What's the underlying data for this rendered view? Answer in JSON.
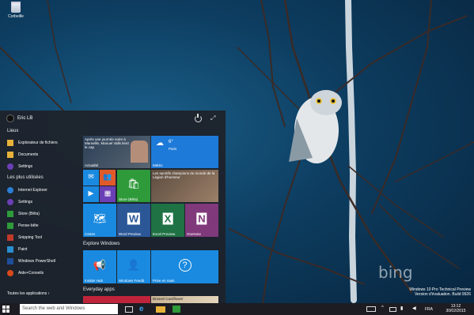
{
  "desktop": {
    "recycle_label": "Corbeille",
    "bing_text": "bing"
  },
  "watermark": {
    "line1": "Windows 10 Pro Technical Preview",
    "line2": "Version d'évaluation. Build 9926"
  },
  "start_menu": {
    "user_name": "Eric LB",
    "places_header": "Lieux",
    "places": [
      "Explorateur de fichiers",
      "Documents",
      "Settings"
    ],
    "most_used_header": "Les plus utilisées",
    "most_used": [
      "Internet Explorer",
      "Settings",
      "Store (Bêta)",
      "Pense-bête",
      "Snipping Tool",
      "Paint",
      "Windows PowerShell",
      "Aide+Conseils"
    ],
    "all_apps": "Toutes les applications ›"
  },
  "tiles": {
    "news_headline": "Après une journée noire à Marseille, Manuel Valls tient le cap",
    "news_label": "Actualité",
    "weather_temp": "6°",
    "weather_city": "Paris",
    "weather_label": "Météo",
    "sports_headline": "Les sportifs champions du monde de la Légion d'honneur",
    "store_label": "Store (Bêta)",
    "cartes_label": "Cartes",
    "word_label": "Word Preview",
    "excel_label": "Excel Preview",
    "onenote_label": "OneNote",
    "explore_header": "Explore Windows",
    "insider_label": "Insider Hub",
    "feedback_label": "Windows Feedb",
    "prise_label": "Prise en main",
    "everyday_header": "Everyday apps",
    "bottom_headline": "Brussel Cauliflower"
  },
  "taskbar": {
    "search_placeholder": "Search the web and Windows",
    "lang": "FRA",
    "time": "13:12",
    "date": "30/02/2015"
  },
  "colors": {
    "accent": "#1e7ad8",
    "store_green": "#2f9a3a"
  }
}
